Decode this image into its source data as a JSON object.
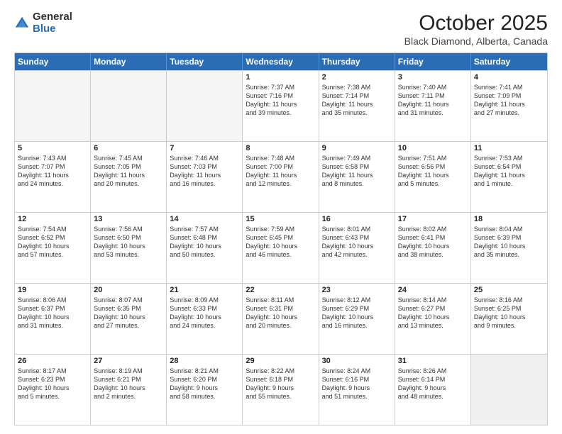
{
  "header": {
    "logo_general": "General",
    "logo_blue": "Blue",
    "month_title": "October 2025",
    "location": "Black Diamond, Alberta, Canada"
  },
  "weekdays": [
    "Sunday",
    "Monday",
    "Tuesday",
    "Wednesday",
    "Thursday",
    "Friday",
    "Saturday"
  ],
  "rows": [
    [
      {
        "day": "",
        "text": "",
        "empty": true
      },
      {
        "day": "",
        "text": "",
        "empty": true
      },
      {
        "day": "",
        "text": "",
        "empty": true
      },
      {
        "day": "1",
        "text": "Sunrise: 7:37 AM\nSunset: 7:16 PM\nDaylight: 11 hours\nand 39 minutes."
      },
      {
        "day": "2",
        "text": "Sunrise: 7:38 AM\nSunset: 7:14 PM\nDaylight: 11 hours\nand 35 minutes."
      },
      {
        "day": "3",
        "text": "Sunrise: 7:40 AM\nSunset: 7:11 PM\nDaylight: 11 hours\nand 31 minutes."
      },
      {
        "day": "4",
        "text": "Sunrise: 7:41 AM\nSunset: 7:09 PM\nDaylight: 11 hours\nand 27 minutes."
      }
    ],
    [
      {
        "day": "5",
        "text": "Sunrise: 7:43 AM\nSunset: 7:07 PM\nDaylight: 11 hours\nand 24 minutes."
      },
      {
        "day": "6",
        "text": "Sunrise: 7:45 AM\nSunset: 7:05 PM\nDaylight: 11 hours\nand 20 minutes."
      },
      {
        "day": "7",
        "text": "Sunrise: 7:46 AM\nSunset: 7:03 PM\nDaylight: 11 hours\nand 16 minutes."
      },
      {
        "day": "8",
        "text": "Sunrise: 7:48 AM\nSunset: 7:00 PM\nDaylight: 11 hours\nand 12 minutes."
      },
      {
        "day": "9",
        "text": "Sunrise: 7:49 AM\nSunset: 6:58 PM\nDaylight: 11 hours\nand 8 minutes."
      },
      {
        "day": "10",
        "text": "Sunrise: 7:51 AM\nSunset: 6:56 PM\nDaylight: 11 hours\nand 5 minutes."
      },
      {
        "day": "11",
        "text": "Sunrise: 7:53 AM\nSunset: 6:54 PM\nDaylight: 11 hours\nand 1 minute."
      }
    ],
    [
      {
        "day": "12",
        "text": "Sunrise: 7:54 AM\nSunset: 6:52 PM\nDaylight: 10 hours\nand 57 minutes."
      },
      {
        "day": "13",
        "text": "Sunrise: 7:56 AM\nSunset: 6:50 PM\nDaylight: 10 hours\nand 53 minutes."
      },
      {
        "day": "14",
        "text": "Sunrise: 7:57 AM\nSunset: 6:48 PM\nDaylight: 10 hours\nand 50 minutes."
      },
      {
        "day": "15",
        "text": "Sunrise: 7:59 AM\nSunset: 6:45 PM\nDaylight: 10 hours\nand 46 minutes."
      },
      {
        "day": "16",
        "text": "Sunrise: 8:01 AM\nSunset: 6:43 PM\nDaylight: 10 hours\nand 42 minutes."
      },
      {
        "day": "17",
        "text": "Sunrise: 8:02 AM\nSunset: 6:41 PM\nDaylight: 10 hours\nand 38 minutes."
      },
      {
        "day": "18",
        "text": "Sunrise: 8:04 AM\nSunset: 6:39 PM\nDaylight: 10 hours\nand 35 minutes."
      }
    ],
    [
      {
        "day": "19",
        "text": "Sunrise: 8:06 AM\nSunset: 6:37 PM\nDaylight: 10 hours\nand 31 minutes."
      },
      {
        "day": "20",
        "text": "Sunrise: 8:07 AM\nSunset: 6:35 PM\nDaylight: 10 hours\nand 27 minutes."
      },
      {
        "day": "21",
        "text": "Sunrise: 8:09 AM\nSunset: 6:33 PM\nDaylight: 10 hours\nand 24 minutes."
      },
      {
        "day": "22",
        "text": "Sunrise: 8:11 AM\nSunset: 6:31 PM\nDaylight: 10 hours\nand 20 minutes."
      },
      {
        "day": "23",
        "text": "Sunrise: 8:12 AM\nSunset: 6:29 PM\nDaylight: 10 hours\nand 16 minutes."
      },
      {
        "day": "24",
        "text": "Sunrise: 8:14 AM\nSunset: 6:27 PM\nDaylight: 10 hours\nand 13 minutes."
      },
      {
        "day": "25",
        "text": "Sunrise: 8:16 AM\nSunset: 6:25 PM\nDaylight: 10 hours\nand 9 minutes."
      }
    ],
    [
      {
        "day": "26",
        "text": "Sunrise: 8:17 AM\nSunset: 6:23 PM\nDaylight: 10 hours\nand 5 minutes."
      },
      {
        "day": "27",
        "text": "Sunrise: 8:19 AM\nSunset: 6:21 PM\nDaylight: 10 hours\nand 2 minutes."
      },
      {
        "day": "28",
        "text": "Sunrise: 8:21 AM\nSunset: 6:20 PM\nDaylight: 9 hours\nand 58 minutes."
      },
      {
        "day": "29",
        "text": "Sunrise: 8:22 AM\nSunset: 6:18 PM\nDaylight: 9 hours\nand 55 minutes."
      },
      {
        "day": "30",
        "text": "Sunrise: 8:24 AM\nSunset: 6:16 PM\nDaylight: 9 hours\nand 51 minutes."
      },
      {
        "day": "31",
        "text": "Sunrise: 8:26 AM\nSunset: 6:14 PM\nDaylight: 9 hours\nand 48 minutes."
      },
      {
        "day": "",
        "text": "",
        "empty": true,
        "shaded": true
      }
    ]
  ]
}
